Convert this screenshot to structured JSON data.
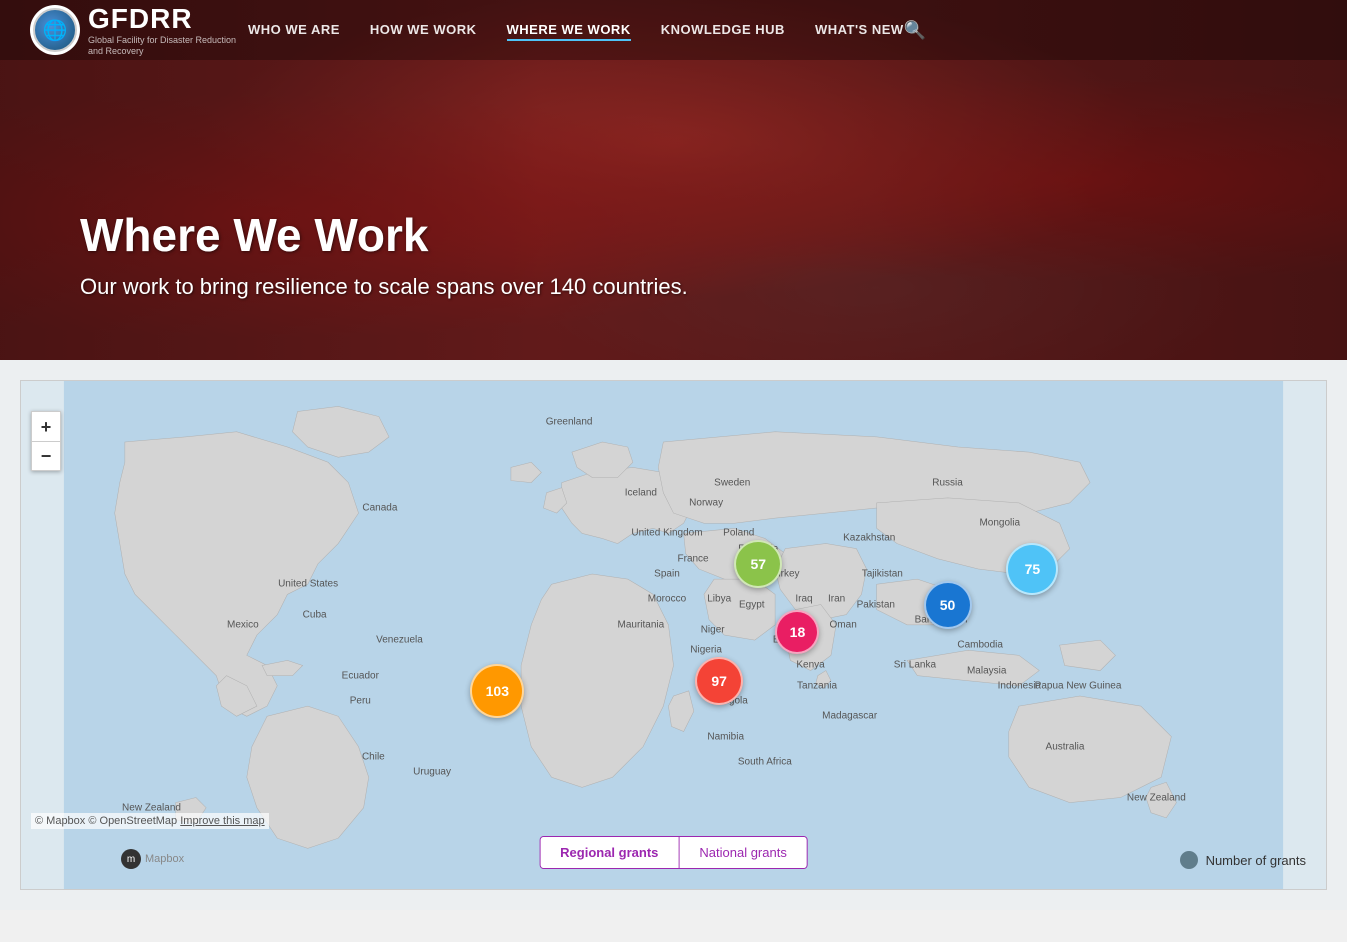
{
  "nav": {
    "logo_text": "GFDRR",
    "logo_subtext": "Global Facility for Disaster Reduction and Recovery",
    "links": [
      {
        "label": "WHO WE ARE",
        "active": false
      },
      {
        "label": "HOW WE WORK",
        "active": false
      },
      {
        "label": "WHERE WE WORK",
        "active": true
      },
      {
        "label": "KNOWLEDGE HUB",
        "active": false
      },
      {
        "label": "WHAT'S NEW",
        "active": false
      }
    ]
  },
  "hero": {
    "title": "Where We Work",
    "subtitle": "Our work to bring resilience to scale spans over 140 countries."
  },
  "map": {
    "attribution": "© Mapbox © OpenStreetMap",
    "improve_link": "Improve this map",
    "zoom_in": "+",
    "zoom_out": "−",
    "clusters": [
      {
        "id": "europe",
        "value": "57",
        "color": "#8bc34a",
        "size": 48,
        "left_pct": 56.5,
        "top_pct": 36
      },
      {
        "id": "central-asia",
        "value": "75",
        "color": "#4fc3f7",
        "size": 52,
        "left_pct": 77.5,
        "top_pct": 37
      },
      {
        "id": "south-asia",
        "value": "50",
        "color": "#1976d2",
        "size": 48,
        "left_pct": 71,
        "top_pct": 44
      },
      {
        "id": "middle-east",
        "value": "18",
        "color": "#e91e63",
        "size": 44,
        "left_pct": 59.5,
        "top_pct": 49.5
      },
      {
        "id": "africa",
        "value": "97",
        "color": "#f44336",
        "size": 48,
        "left_pct": 53.5,
        "top_pct": 59
      },
      {
        "id": "south-america",
        "value": "103",
        "color": "#ff9800",
        "size": 54,
        "left_pct": 36.5,
        "top_pct": 61
      }
    ],
    "toggles": [
      {
        "label": "Regional grants",
        "active": true
      },
      {
        "label": "National grants",
        "active": false
      }
    ],
    "legend": {
      "label": "Number of grants"
    },
    "mapbox_label": "Mapbox"
  },
  "country_labels": [
    {
      "name": "Greenland",
      "left_pct": 42,
      "top_pct": 8
    },
    {
      "name": "Iceland",
      "left_pct": 47.5,
      "top_pct": 22
    },
    {
      "name": "Sweden",
      "left_pct": 54.5,
      "top_pct": 20
    },
    {
      "name": "Norway",
      "left_pct": 52.5,
      "top_pct": 24
    },
    {
      "name": "Russia",
      "left_pct": 71,
      "top_pct": 20
    },
    {
      "name": "United Kingdom",
      "left_pct": 49.5,
      "top_pct": 30
    },
    {
      "name": "France",
      "left_pct": 51.5,
      "top_pct": 35
    },
    {
      "name": "Poland",
      "left_pct": 55,
      "top_pct": 30
    },
    {
      "name": "Romania",
      "left_pct": 56.5,
      "top_pct": 33
    },
    {
      "name": "Spain",
      "left_pct": 49.5,
      "top_pct": 38
    },
    {
      "name": "Turkey",
      "left_pct": 58.5,
      "top_pct": 38
    },
    {
      "name": "Kazakhstan",
      "left_pct": 65,
      "top_pct": 31
    },
    {
      "name": "Mongolia",
      "left_pct": 75,
      "top_pct": 28
    },
    {
      "name": "Morocco",
      "left_pct": 49.5,
      "top_pct": 43
    },
    {
      "name": "Libya",
      "left_pct": 53.5,
      "top_pct": 43
    },
    {
      "name": "Egypt",
      "left_pct": 56,
      "top_pct": 44
    },
    {
      "name": "Iraq",
      "left_pct": 60,
      "top_pct": 43
    },
    {
      "name": "Iran",
      "left_pct": 62.5,
      "top_pct": 43
    },
    {
      "name": "Pakistan",
      "left_pct": 65.5,
      "top_pct": 44
    },
    {
      "name": "Bangladesh",
      "left_pct": 70.5,
      "top_pct": 47
    },
    {
      "name": "Tajikistan",
      "left_pct": 66,
      "top_pct": 38
    },
    {
      "name": "Oman",
      "left_pct": 63,
      "top_pct": 48
    },
    {
      "name": "Canada",
      "left_pct": 27.5,
      "top_pct": 25
    },
    {
      "name": "United States",
      "left_pct": 22,
      "top_pct": 40
    },
    {
      "name": "Mexico",
      "left_pct": 17,
      "top_pct": 48
    },
    {
      "name": "Cuba",
      "left_pct": 22.5,
      "top_pct": 46
    },
    {
      "name": "Venezuela",
      "left_pct": 29,
      "top_pct": 51
    },
    {
      "name": "Ecuador",
      "left_pct": 26,
      "top_pct": 58
    },
    {
      "name": "Peru",
      "left_pct": 26,
      "top_pct": 63
    },
    {
      "name": "Chile",
      "left_pct": 27,
      "top_pct": 74
    },
    {
      "name": "Uruguay",
      "left_pct": 31.5,
      "top_pct": 77
    },
    {
      "name": "Mauritania",
      "left_pct": 47.5,
      "top_pct": 48
    },
    {
      "name": "Niger",
      "left_pct": 53,
      "top_pct": 49
    },
    {
      "name": "Nigeria",
      "left_pct": 52.5,
      "top_pct": 53
    },
    {
      "name": "Ethiopia",
      "left_pct": 59,
      "top_pct": 51
    },
    {
      "name": "Kenya",
      "left_pct": 60.5,
      "top_pct": 56
    },
    {
      "name": "Tanzania",
      "left_pct": 61,
      "top_pct": 60
    },
    {
      "name": "Angola",
      "left_pct": 54.5,
      "top_pct": 63
    },
    {
      "name": "Namibia",
      "left_pct": 54,
      "top_pct": 70
    },
    {
      "name": "South Africa",
      "left_pct": 57,
      "top_pct": 75
    },
    {
      "name": "Madagascar",
      "left_pct": 63.5,
      "top_pct": 66
    },
    {
      "name": "Sri Lanka",
      "left_pct": 68.5,
      "top_pct": 56
    },
    {
      "name": "Cambodia",
      "left_pct": 73.5,
      "top_pct": 52
    },
    {
      "name": "Malaysia",
      "left_pct": 74,
      "top_pct": 57
    },
    {
      "name": "Indonesia",
      "left_pct": 76.5,
      "top_pct": 60
    },
    {
      "name": "Papua New Guinea",
      "left_pct": 81,
      "top_pct": 60
    },
    {
      "name": "Australia",
      "left_pct": 80,
      "top_pct": 72
    },
    {
      "name": "New Zealand",
      "left_pct": 87,
      "top_pct": 82
    },
    {
      "name": "New Zealand",
      "left_pct": 10,
      "top_pct": 84
    }
  ]
}
